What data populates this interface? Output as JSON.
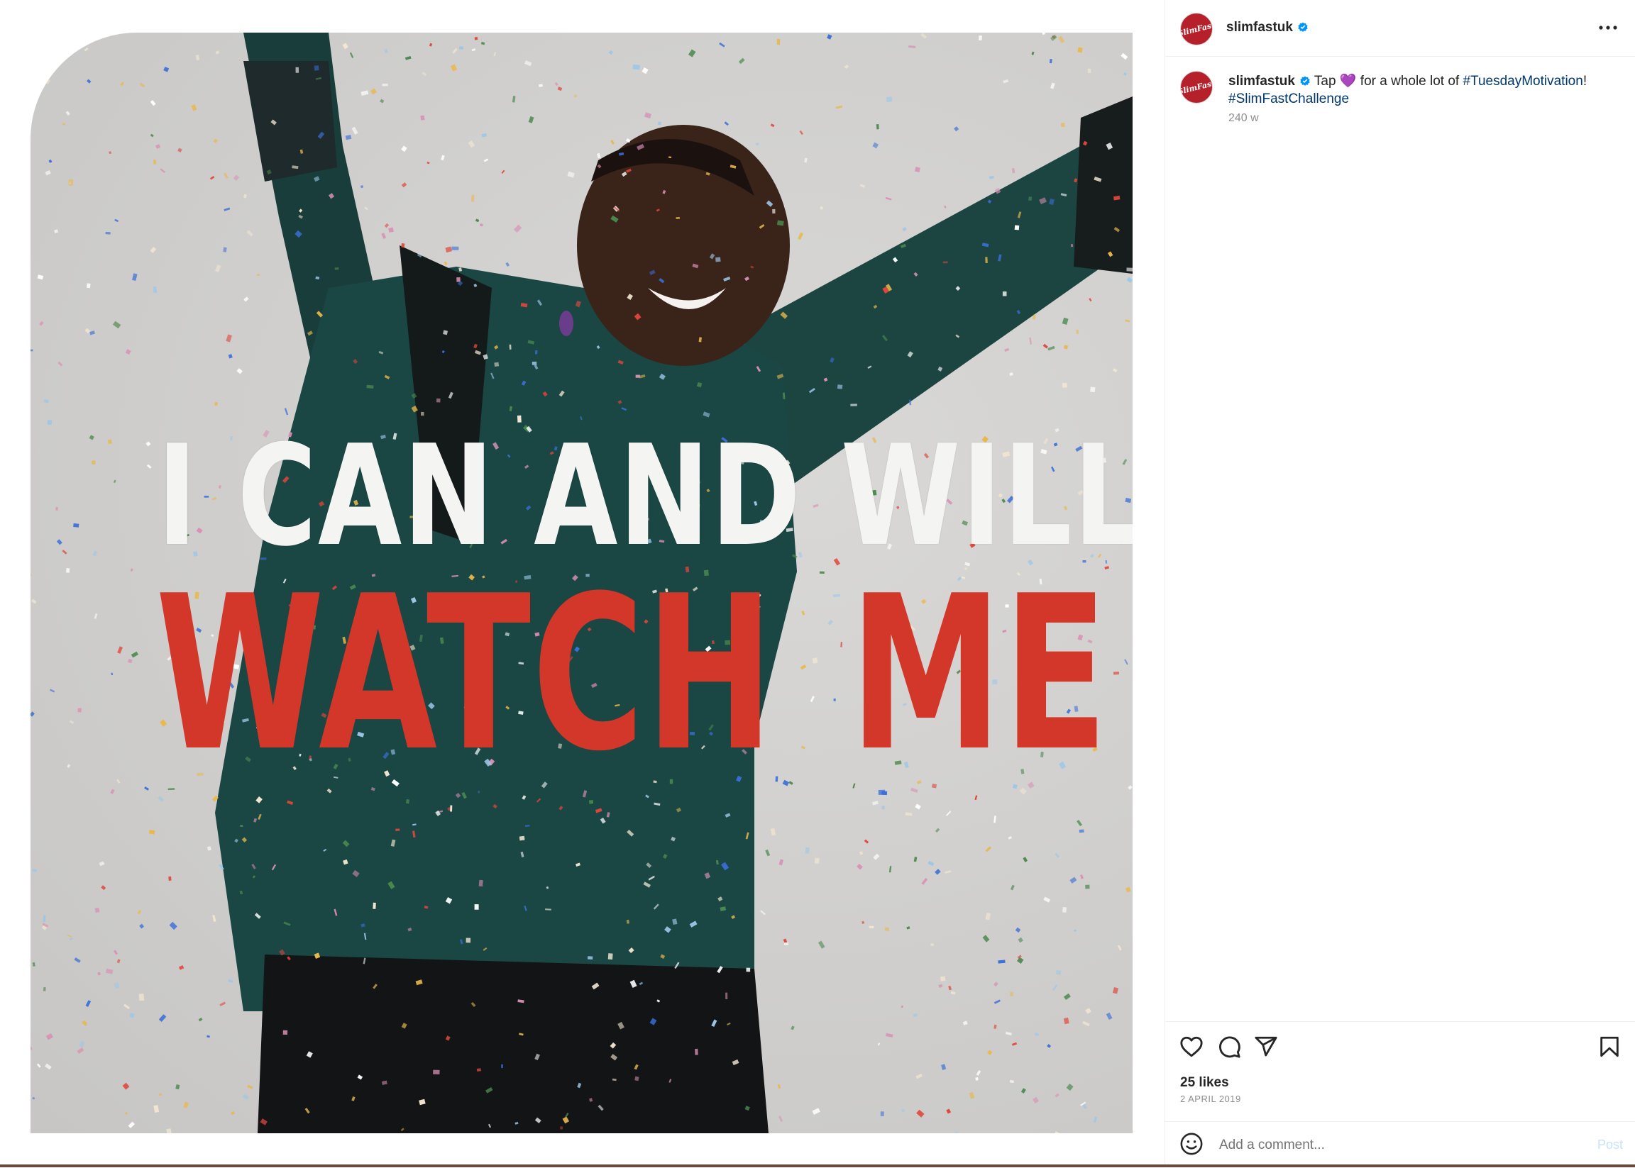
{
  "post": {
    "image_alt": "Woman in green velvet jacket celebrating in confetti",
    "overlay_line_1": "I CAN AND WILL.",
    "overlay_line_2": "WATCH ME",
    "overlay_colors": {
      "line_1": "#f4f4f2",
      "line_2": "#d2372a"
    }
  },
  "header": {
    "username": "slimfastuk",
    "verified": true,
    "more_icon": "more-horizontal-icon"
  },
  "caption": {
    "username": "slimfastuk",
    "text_before_emoji": " Tap ",
    "emoji": "💜",
    "text_after_emoji": " for a whole lot of ",
    "hashtag_1": "#TuesdayMotivation",
    "punctuation": "!",
    "hashtag_2": "#SlimFastChallenge",
    "time": "240 w"
  },
  "actions": {
    "like_icon": "heart-icon",
    "comment_icon": "comment-bubble-icon",
    "share_icon": "paper-plane-icon",
    "save_icon": "bookmark-icon",
    "likes": "25 likes",
    "date": "2 APRIL 2019"
  },
  "comment": {
    "emoji_icon": "smiley-icon",
    "placeholder": "Add a comment...",
    "post_label": "Post"
  },
  "colors": {
    "avatar": "#b5202a",
    "hashtag": "#00376b",
    "verified": "#0095f6",
    "post_disabled": "#c7e1fc"
  }
}
